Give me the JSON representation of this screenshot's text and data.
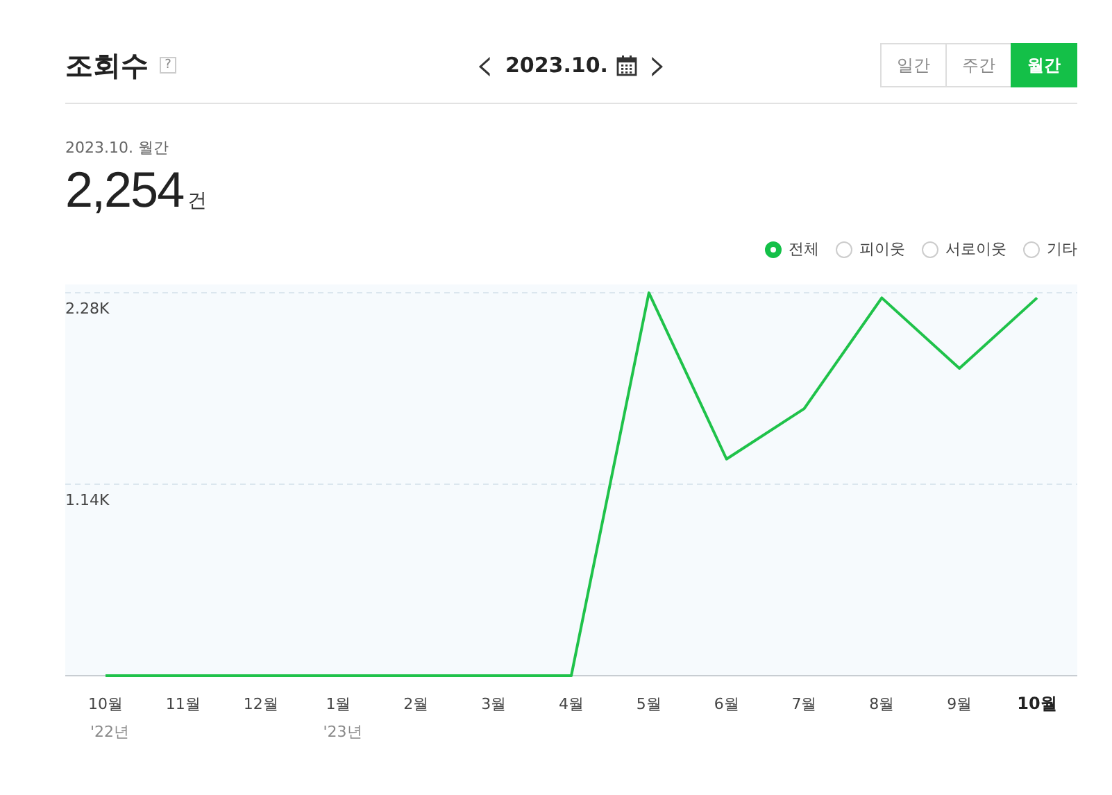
{
  "header": {
    "title": "조회수",
    "help": "?",
    "period": "2023.10.",
    "prev": "‹",
    "next": "›"
  },
  "view_tabs": [
    {
      "label": "일간",
      "selected": false
    },
    {
      "label": "주간",
      "selected": false
    },
    {
      "label": "월간",
      "selected": true
    }
  ],
  "summary": {
    "caption": "2023.10. 월간",
    "value": "2,254",
    "unit": "건"
  },
  "legend": [
    {
      "kind": "series",
      "selected": true
    },
    {
      "kind": "option",
      "label": "피이웃",
      "selected": false
    },
    {
      "kind": "option",
      "label": "서로이웃",
      "selected": false
    },
    {
      "kind": "option",
      "label": "기타",
      "selected": false
    }
  ],
  "chart": {
    "chart_data": {
      "type": "line",
      "categories": [
        "10월",
        "11월",
        "12월",
        "1월",
        "2월",
        "3월",
        "4월",
        "5월",
        "6월",
        "7월",
        "8월",
        "9월",
        "10월"
      ],
      "series": [
        {
          "name": "전체",
          "color": "#1fc24a",
          "values": [
            0,
            0,
            0,
            0,
            0,
            0,
            0,
            2280,
            1290,
            1590,
            2250,
            1830,
            2250
          ]
        }
      ],
      "ylim": [
        0,
        2330
      ],
      "yticks": [
        {
          "value": 1140,
          "label": "1.14K"
        },
        {
          "value": 2280,
          "label": "2.28K"
        }
      ]
    },
    "x_label_states": [
      {
        "selected": false,
        "year": "'22년"
      },
      {
        "selected": false
      },
      {
        "selected": false
      },
      {
        "selected": false,
        "year": "'23년"
      },
      {
        "selected": false
      },
      {
        "selected": false
      },
      {
        "selected": false
      },
      {
        "selected": false
      },
      {
        "selected": false
      },
      {
        "selected": false
      },
      {
        "selected": false
      },
      {
        "selected": false
      },
      {
        "selected": true
      }
    ]
  }
}
